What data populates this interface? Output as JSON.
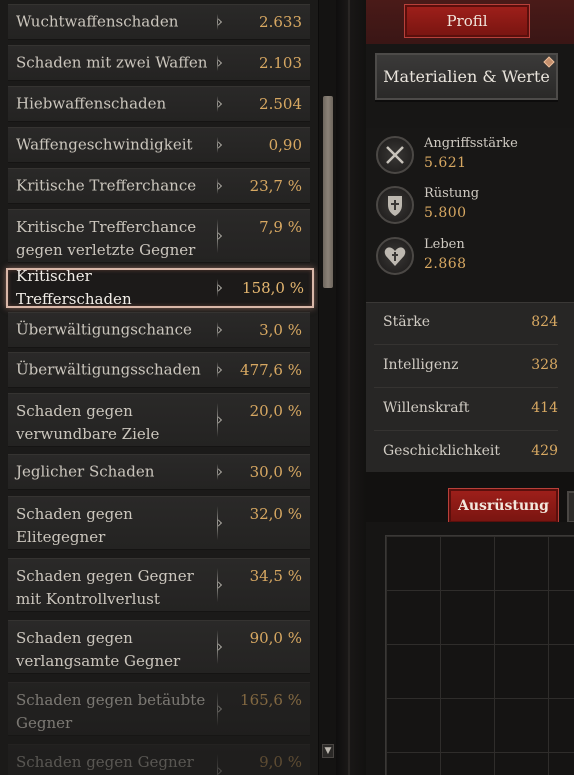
{
  "stats": [
    {
      "label": "Wuchtwaffenschaden",
      "value": "2.633"
    },
    {
      "label": "Schaden mit zwei Waffen",
      "value": "2.103"
    },
    {
      "label": "Hiebwaffenschaden",
      "value": "2.504"
    },
    {
      "label": "Waffengeschwindigkeit",
      "value": "0,90"
    },
    {
      "label": "Kritische Trefferchance",
      "value": "23,7 %"
    },
    {
      "label": "Kritische Trefferchance gegen verletzte Gegner",
      "value": "7,9 %"
    },
    {
      "label": "Kritischer Trefferschaden",
      "value": "158,0 %"
    },
    {
      "label": "Überwältigungschance",
      "value": "3,0 %"
    },
    {
      "label": "Überwältigungsschaden",
      "value": "477,6 %"
    },
    {
      "label": "Schaden gegen verwundbare Ziele",
      "value": "20,0 %"
    },
    {
      "label": "Jeglicher Schaden",
      "value": "30,0 %"
    },
    {
      "label": "Schaden gegen Elitegegner",
      "value": "32,0 %"
    },
    {
      "label": "Schaden gegen Gegner mit Kontrollverlust",
      "value": "34,5 %"
    },
    {
      "label": "Schaden gegen verlangsamte Gegner",
      "value": "90,0 %"
    },
    {
      "label": "Schaden gegen betäubte Gegner",
      "value": "165,6 %"
    },
    {
      "label": "Schaden gegen Gegner in",
      "value": "9,0 %"
    }
  ],
  "scroll": {
    "down_glyph": "▼"
  },
  "profile": {
    "button_label": "Profil",
    "materials_label": "Materialien & Werte"
  },
  "attributes": [
    {
      "label": "Angriffsstärke",
      "value": "5.621",
      "icon": "crossed-swords-icon"
    },
    {
      "label": "Rüstung",
      "value": "5.800",
      "icon": "shield-icon"
    },
    {
      "label": "Leben",
      "value": "2.868",
      "icon": "heart-icon"
    }
  ],
  "core_stats": [
    {
      "label": "Stärke",
      "value": "824"
    },
    {
      "label": "Intelligenz",
      "value": "328"
    },
    {
      "label": "Willenskraft",
      "value": "414"
    },
    {
      "label": "Geschicklichkeit",
      "value": "429"
    }
  ],
  "tabs": {
    "equipment_label": "Ausrüstung"
  },
  "colors": {
    "accent_red": "#9d1f1a",
    "value_gold": "#d7a862",
    "highlight_border": "#d9b7a8"
  }
}
